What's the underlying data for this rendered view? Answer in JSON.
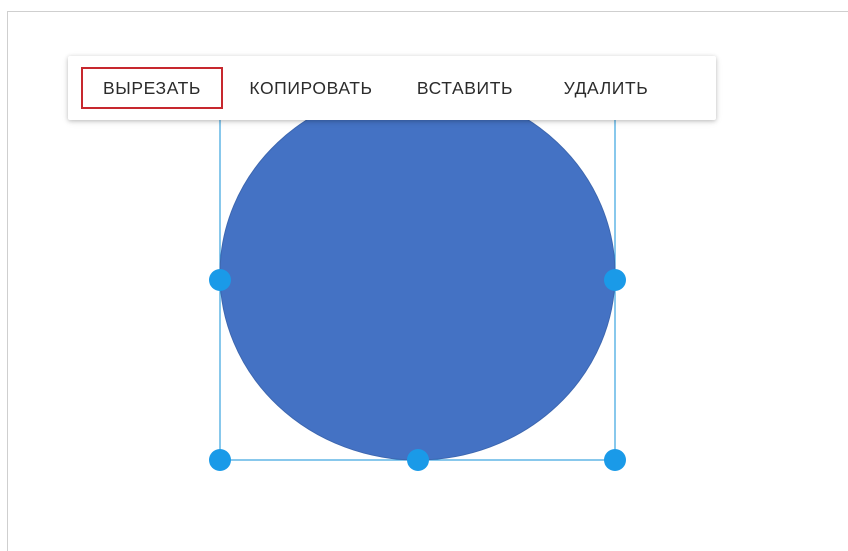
{
  "context_menu": {
    "items": [
      {
        "label": "ВЫРЕЗАТЬ",
        "highlighted": true
      },
      {
        "label": "КОПИРОВАТЬ",
        "highlighted": false
      },
      {
        "label": "ВСТАВИТЬ",
        "highlighted": false
      },
      {
        "label": "УДАЛИТЬ",
        "highlighted": false
      }
    ],
    "highlight_color": "#c7282e"
  },
  "shape": {
    "type": "ellipse",
    "fill_color": "#4472c4",
    "selection_color": "#1a9ae8"
  }
}
